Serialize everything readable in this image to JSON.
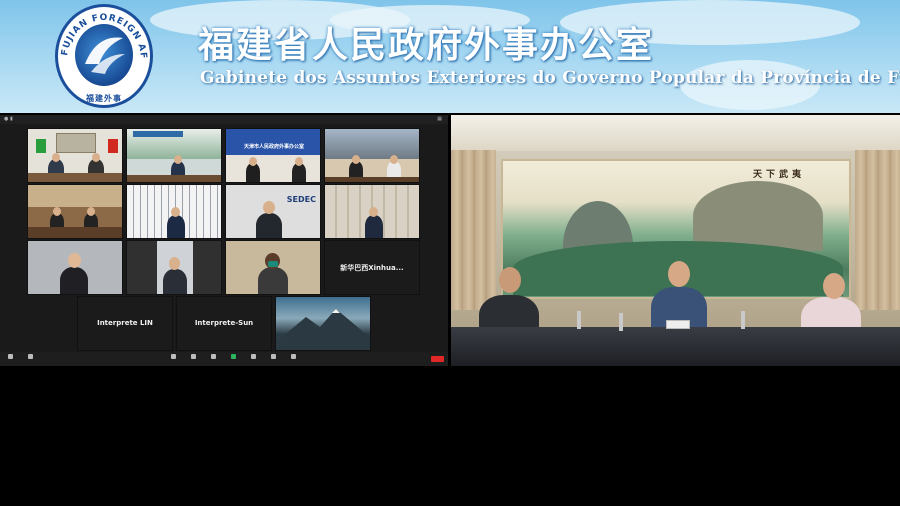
{
  "banner": {
    "title_cn": "福建省人民政府外事办公室",
    "title_pt": "Gabinete dos Assuntos Exteriores do Governo Popular da Província de Fujian",
    "logo_text": "FUJIAN FOREIGN AFFAIRS",
    "logo_text_cn": "福建外事"
  },
  "zoom": {
    "tiles_text": {
      "xinhua": "新华巴西Xinhua...",
      "interp_lin": "Interprete LIN",
      "interp_sun": "Interprete-Sun"
    },
    "tile_sign_tianjin": "天津市人民政府外事办公室",
    "tile_sign_sedec": "SEDEC",
    "end_label": "结束"
  },
  "room": {
    "painting_caption": "天下武夷"
  },
  "colors": {
    "banner_top": "#7fc4ea",
    "title_text": "#ffffff",
    "end_button": "#e02828"
  }
}
